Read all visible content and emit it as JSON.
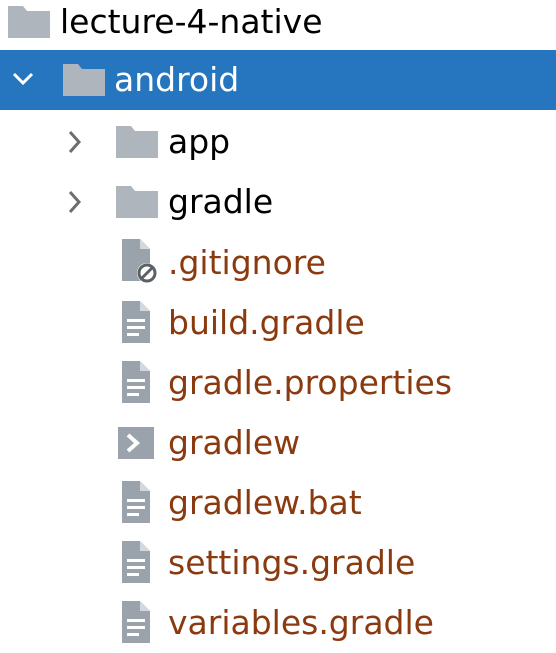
{
  "colors": {
    "selection": "#2675bf",
    "folder_icon": "#aeb5bc",
    "file_icon": "#9aa3ab",
    "file_text": "#8b3a0f",
    "folder_text": "#000000",
    "selected_text": "#ffffff"
  },
  "tree": {
    "root": {
      "label": "lecture-4-native",
      "icon": "folder-icon"
    },
    "selected": {
      "label": "android",
      "icon": "folder-icon",
      "expanded": true
    },
    "children": [
      {
        "label": "app",
        "icon": "folder-icon",
        "expandable": true
      },
      {
        "label": "gradle",
        "icon": "folder-icon",
        "expandable": true
      },
      {
        "label": ".gitignore",
        "icon": "ignored-file-icon"
      },
      {
        "label": "build.gradle",
        "icon": "text-file-icon"
      },
      {
        "label": "gradle.properties",
        "icon": "text-file-icon"
      },
      {
        "label": "gradlew",
        "icon": "script-file-icon"
      },
      {
        "label": "gradlew.bat",
        "icon": "text-file-icon"
      },
      {
        "label": "settings.gradle",
        "icon": "text-file-icon"
      },
      {
        "label": "variables.gradle",
        "icon": "text-file-icon"
      }
    ]
  }
}
